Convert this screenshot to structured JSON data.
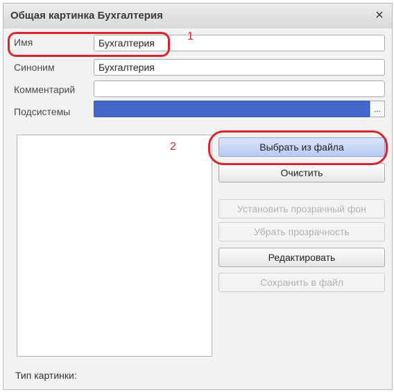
{
  "window": {
    "title": "Общая картинка Бухгалтерия",
    "close_glyph": "×"
  },
  "form": {
    "name": {
      "label": "Имя",
      "value": "Бухгалтерия"
    },
    "synonym": {
      "label": "Синоним",
      "value": "Бухгалтерия"
    },
    "comment": {
      "label": "Комментарий",
      "value": ""
    },
    "subsystems": {
      "label": "Подсистемы",
      "value": "",
      "select_glyph": "..."
    }
  },
  "buttons": {
    "choose_file": "Выбрать из файла",
    "clear": "Очистить",
    "set_transparent_bg": "Установить прозрачный фон",
    "remove_transparency": "Убрать прозрачность",
    "edit": "Редактировать",
    "save_to_file": "Сохранить в файл"
  },
  "picture_type_label": "Тип картинки:",
  "annotations": {
    "first": "1",
    "second": "2"
  },
  "colors": {
    "subsystems_fill": "#4468c9",
    "annotation": "#d8232a"
  }
}
